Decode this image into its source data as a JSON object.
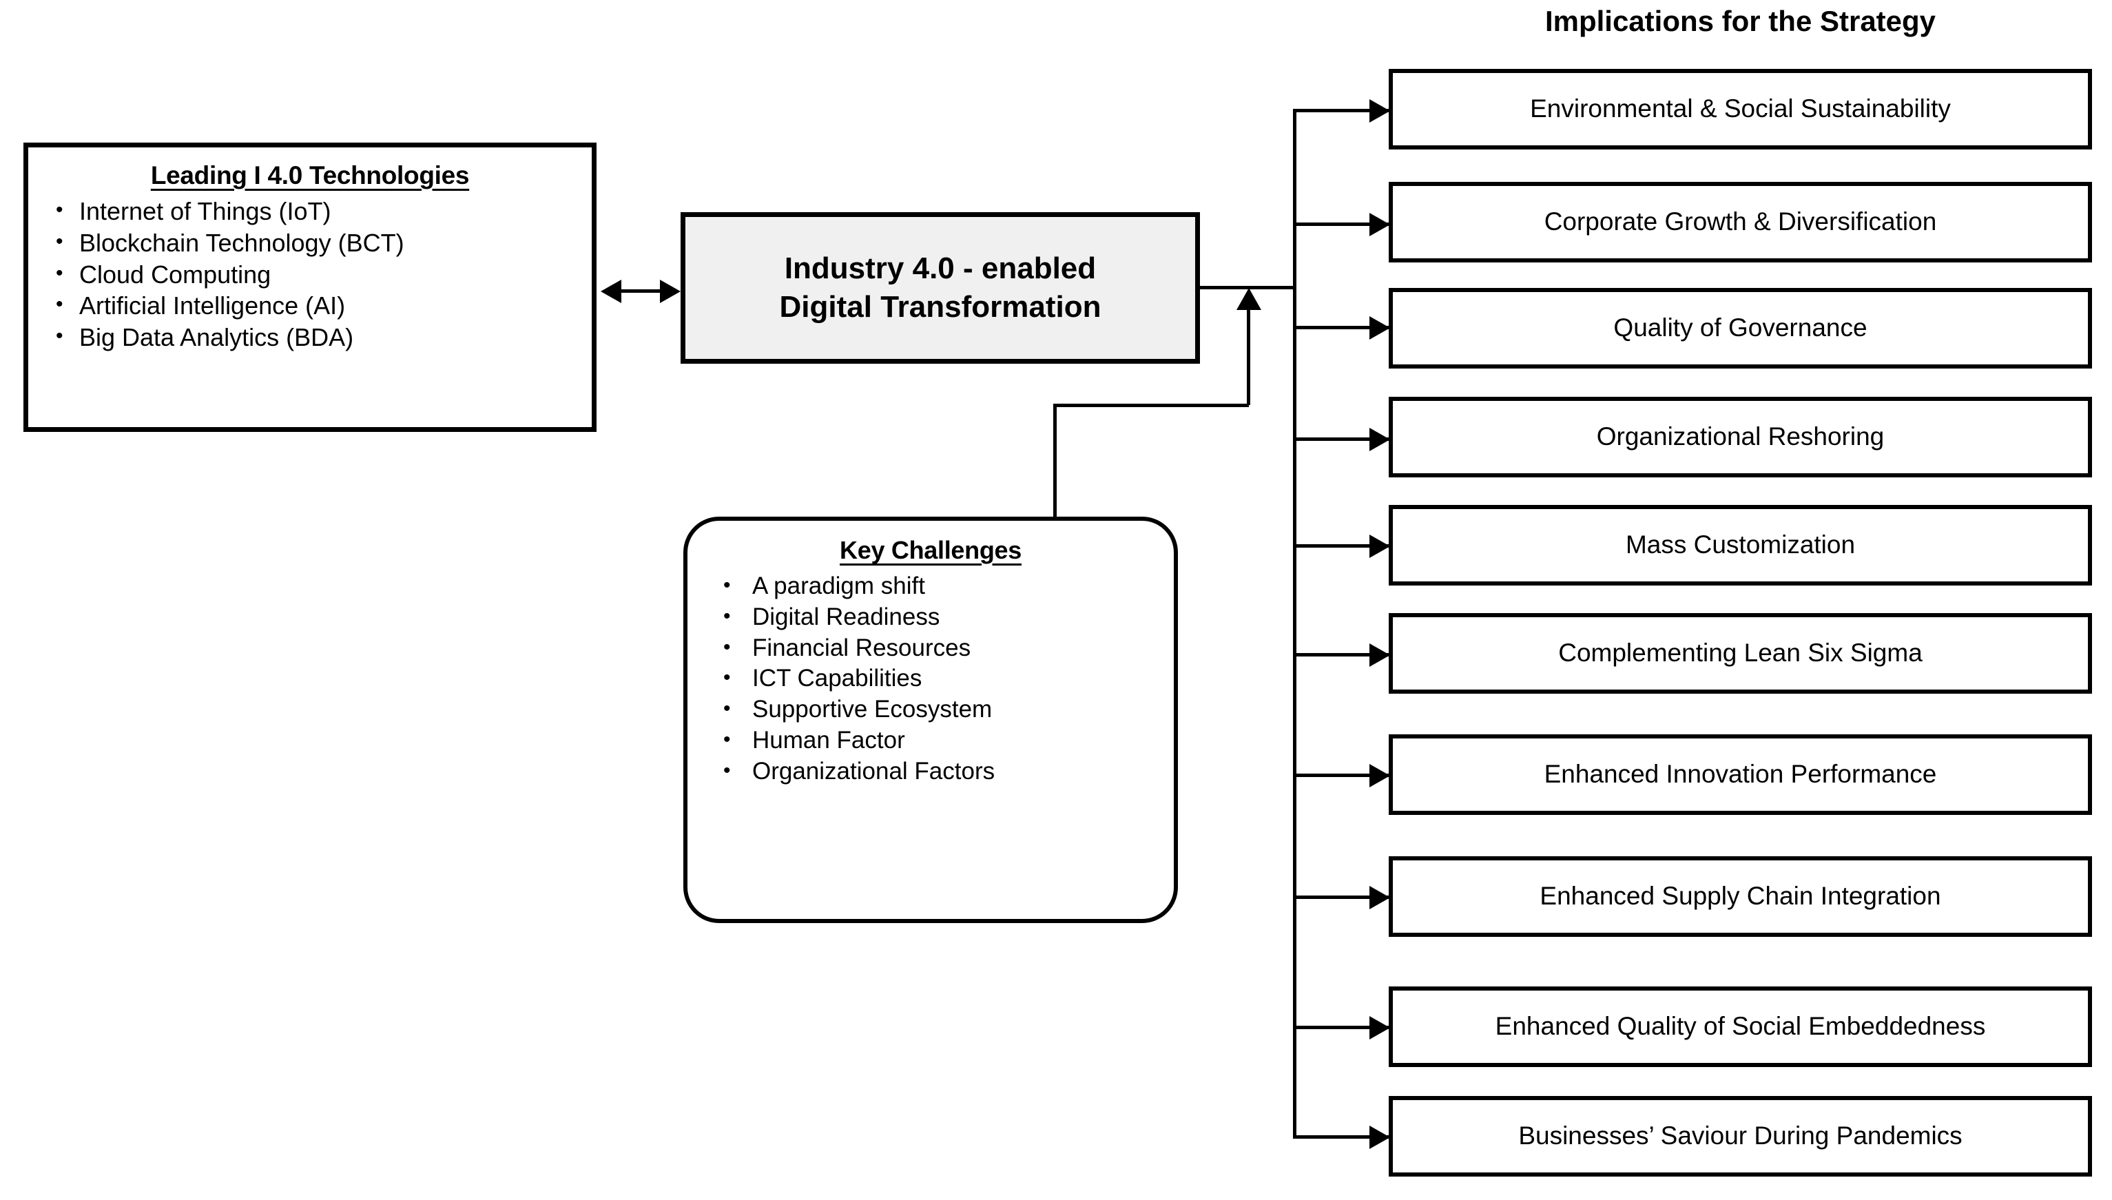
{
  "technologies_panel": {
    "title": "Leading I 4.0 Technologies",
    "bullet": "•",
    "items": [
      "Internet of Things (IoT)",
      "Blockchain Technology (BCT)",
      "Cloud Computing",
      "Artificial Intelligence (AI)",
      "Big Data Analytics (BDA)"
    ]
  },
  "core_node": {
    "label": "Industry 4.0 - enabled\nDigital Transformation",
    "fill_color": "#f0f0f0"
  },
  "challenges_panel": {
    "title": "Key Challenges",
    "bullet": "•",
    "items": [
      "A paradigm shift",
      "Digital Readiness",
      "Financial Resources",
      "ICT Capabilities",
      "Supportive Ecosystem",
      "Human Factor",
      " Organizational Factors"
    ]
  },
  "implications_panel": {
    "title": "Implications for the Strategy",
    "items": [
      "Environmental & Social Sustainability",
      "Corporate Growth & Diversification",
      "Quality of Governance",
      "Organizational Reshoring",
      "Mass Customization",
      "Complementing Lean Six Sigma",
      "Enhanced Innovation Performance",
      "Enhanced Supply Chain Integration",
      "Enhanced Quality of Social Embeddedness",
      "Businesses’ Saviour During Pandemics"
    ]
  },
  "theme": {
    "stroke_color": "#000000",
    "background_color": "#ffffff"
  }
}
